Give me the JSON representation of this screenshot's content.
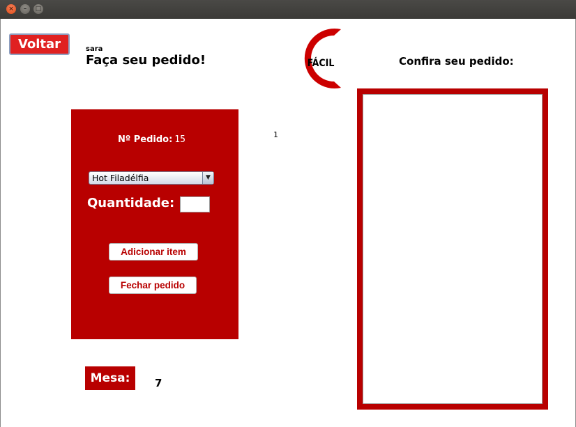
{
  "window": {
    "close_glyph": "×",
    "minimize_glyph": "–",
    "maximize_glyph": "□"
  },
  "header": {
    "back_label": "Voltar",
    "username": "sara",
    "title": "Faça seu pedido!"
  },
  "logo": {
    "letter": "C",
    "text": "FÁCIL",
    "color": "#cc0000"
  },
  "order_panel": {
    "order_label": "Nº Pedido:",
    "order_number": "15",
    "item_select_value": "Hot Filadélfia",
    "select_arrow": "▼",
    "quantity_label": "Quantidade:",
    "quantity_value": "",
    "add_item_label": "Adicionar item",
    "close_order_label": "Fechar pedido",
    "panel_color": "#b80000"
  },
  "counter_value": "1",
  "table": {
    "label": "Mesa:",
    "number": "7"
  },
  "review": {
    "title": "Confira seu pedido:",
    "items": []
  }
}
